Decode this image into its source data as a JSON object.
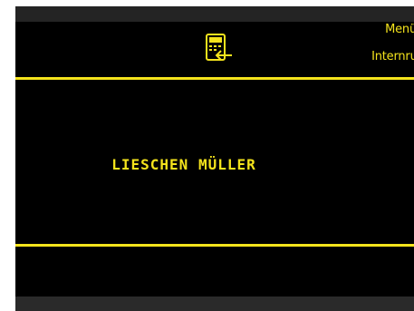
{
  "softkeys": {
    "menu_label": "Menü",
    "intercom_label": "Internruf"
  },
  "header": {
    "icon": "intercom-handset-icon"
  },
  "call": {
    "caller_name": "LIESCHEN MÜLLER"
  },
  "colors": {
    "accent": "#f4e31c",
    "background": "#000000",
    "bezel": "#242424"
  }
}
